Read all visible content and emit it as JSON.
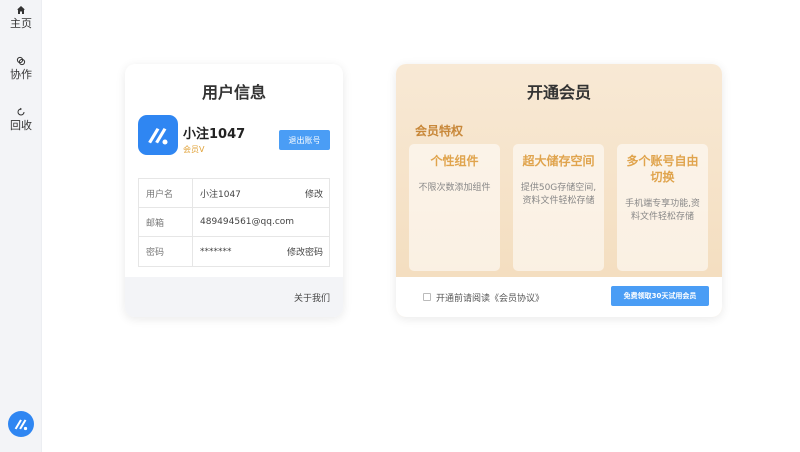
{
  "sidebar": {
    "items": [
      {
        "label": "主页",
        "icon": "home-icon"
      },
      {
        "label": "协作",
        "icon": "link-icon"
      },
      {
        "label": "回收",
        "icon": "recycle-icon"
      }
    ],
    "avatar_icon": "app-logo-icon"
  },
  "user_card": {
    "title": "用户信息",
    "username": "小注1047",
    "member_level": "会员V",
    "logout_label": "退出账号",
    "rows": [
      {
        "label": "用户名",
        "value": "小注1047",
        "action": "修改"
      },
      {
        "label": "邮箱",
        "value": "489494561@qq.com",
        "action": ""
      },
      {
        "label": "密码",
        "value": "*******",
        "action": "修改密码"
      }
    ],
    "about_label": "关于我们"
  },
  "member_card": {
    "title": "开通会员",
    "privilege_title": "会员特权",
    "features": [
      {
        "title": "个性组件",
        "desc": "不限次数添加组件"
      },
      {
        "title": "超大储存空间",
        "desc": "提供50G存储空间,资料文件轻松存储"
      },
      {
        "title": "多个账号自由切换",
        "desc": "手机端专享功能,资料文件轻松存储"
      }
    ],
    "agreement_text": "开通前请阅读《会员协议》",
    "trial_label": "免费领取30天试用会员"
  },
  "colors": {
    "accent": "#4a9df5",
    "logo_blue": "#2f86f2",
    "gold": "#e0a44d"
  }
}
